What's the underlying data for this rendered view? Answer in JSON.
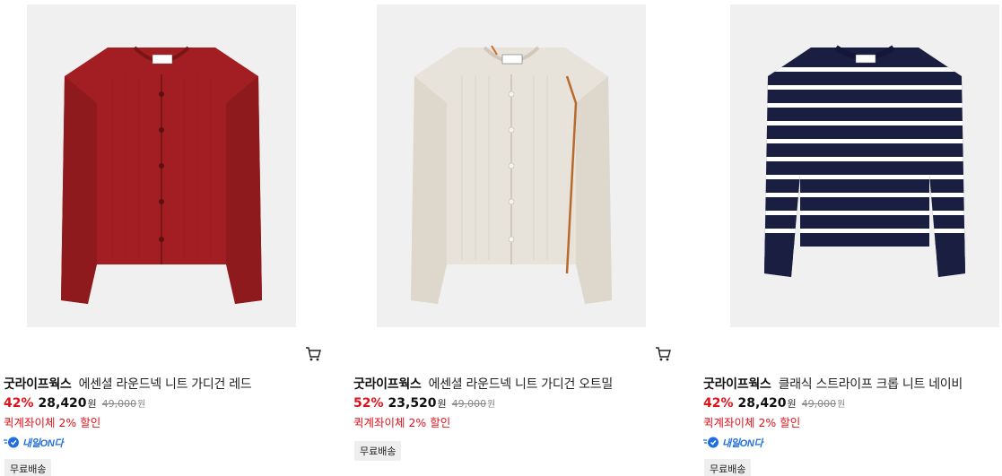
{
  "products": [
    {
      "brand": "굿라이프웍스",
      "name": "에센셜 라운드넥 니트 가디건 레드",
      "discount": "42%",
      "price": "28,420",
      "currency": "원",
      "original_price": "49,000",
      "original_currency": "원",
      "promo": "퀵계좌이체 2% 할인",
      "delivery_label": "내일ON다",
      "badge": "무료배송",
      "image_icon": "red-cardigan-image",
      "color": "#a11d1f"
    },
    {
      "brand": "굿라이프웍스",
      "name": "에센셜 라운드넥 니트 가디건 오트밀",
      "discount": "52%",
      "price": "23,520",
      "currency": "원",
      "original_price": "49,000",
      "original_currency": "원",
      "promo": "퀵계좌이체 2% 할인",
      "badge": "무료배송",
      "image_icon": "oatmeal-cardigan-image",
      "color": "#e9e4db"
    },
    {
      "brand": "굿라이프웍스",
      "name": "클래식 스트라이프 크롭 니트 네이비",
      "discount": "42%",
      "price": "28,420",
      "currency": "원",
      "original_price": "49,000",
      "original_currency": "원",
      "promo": "퀵계좌이체 2% 할인",
      "delivery_label": "내일ON다",
      "badge": "무료배송",
      "image_icon": "navy-striped-knit-image",
      "color": "#1b1f3f"
    }
  ],
  "colors": {
    "discount": "#e0111a",
    "delivery": "#1f6fe0",
    "thumb_bg": "#f0f0f0"
  }
}
